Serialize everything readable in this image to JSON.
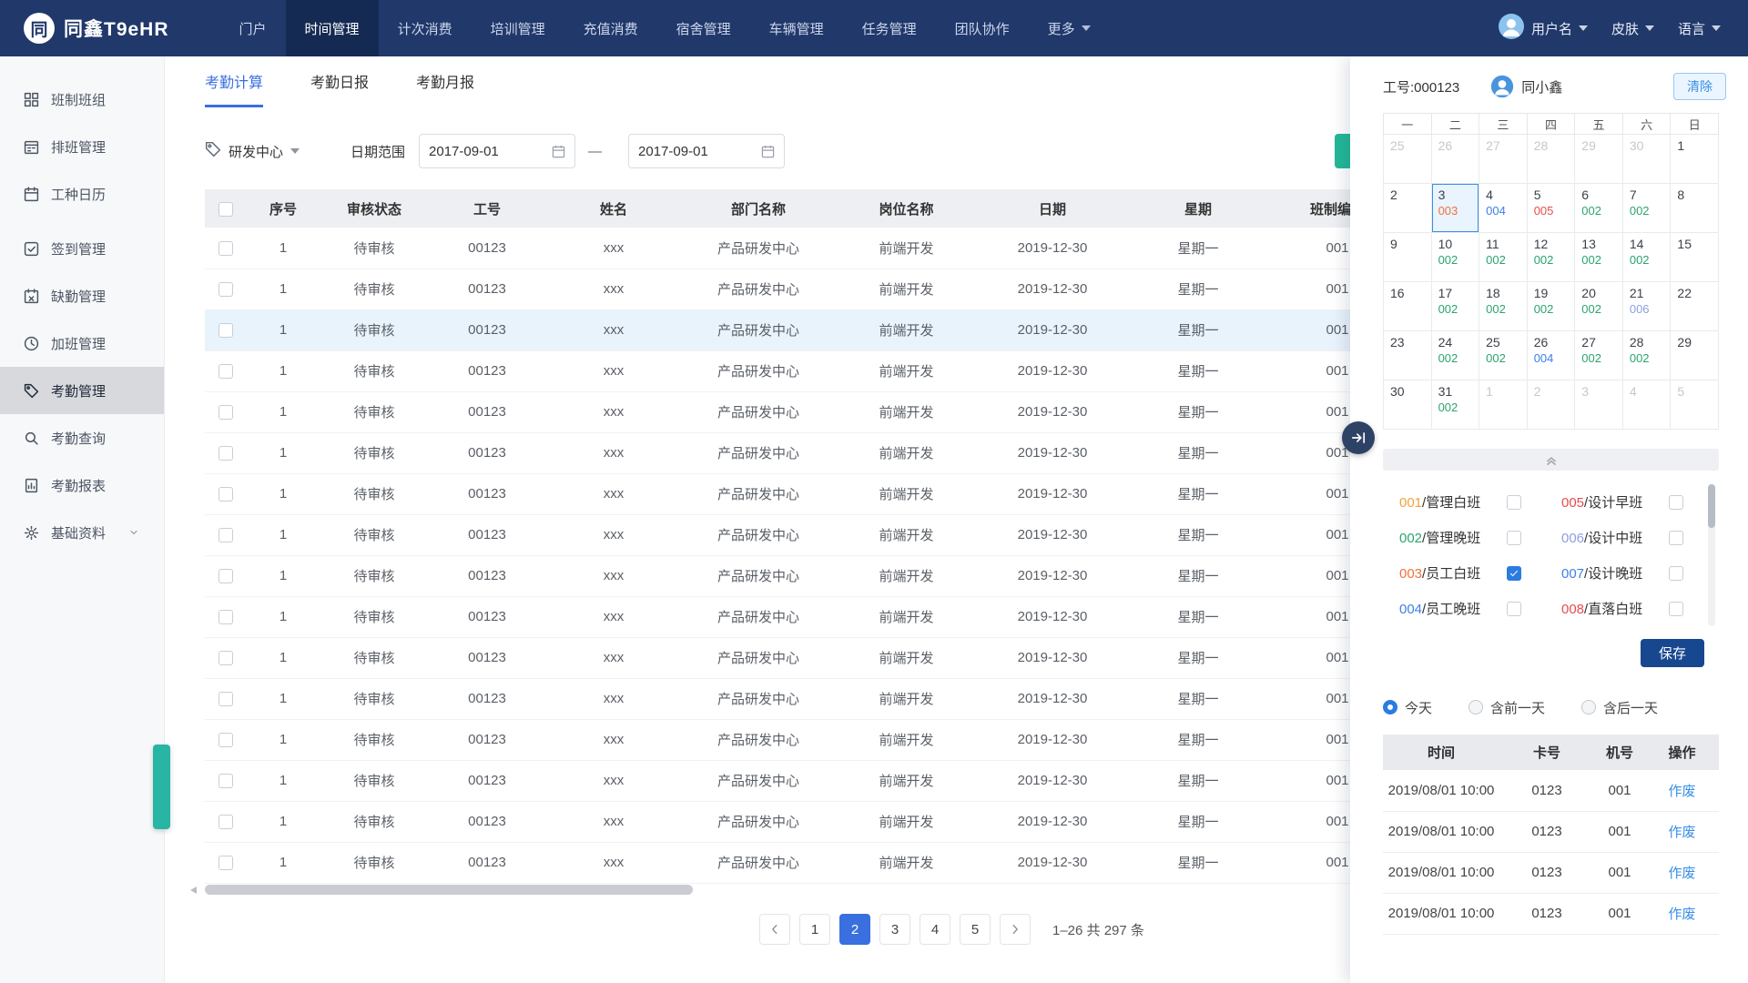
{
  "navbar": {
    "brand": "同鑫T9eHR",
    "logo_text": "同",
    "items": [
      {
        "label": "门户"
      },
      {
        "label": "时间管理",
        "active": true
      },
      {
        "label": "计次消费"
      },
      {
        "label": "培训管理"
      },
      {
        "label": "充值消费"
      },
      {
        "label": "宿舍管理"
      },
      {
        "label": "车辆管理"
      },
      {
        "label": "任务管理"
      },
      {
        "label": "团队协作"
      },
      {
        "label": "更多",
        "dropdown": true
      }
    ],
    "user_label": "用户名",
    "skin_label": "皮肤",
    "language_label": "语言"
  },
  "sidebar": {
    "items": [
      {
        "label": "班制班组",
        "icon": "grid-icon"
      },
      {
        "label": "排班管理",
        "icon": "schedule-icon"
      },
      {
        "label": "工种日历",
        "icon": "calendar-icon"
      },
      {
        "label": "签到管理",
        "icon": "checkin-icon",
        "gap": true
      },
      {
        "label": "缺勤管理",
        "icon": "absence-icon"
      },
      {
        "label": "加班管理",
        "icon": "overtime-icon"
      },
      {
        "label": "考勤管理",
        "icon": "attendance-icon",
        "active": true
      },
      {
        "label": "考勤查询",
        "icon": "query-icon"
      },
      {
        "label": "考勤报表",
        "icon": "report-icon"
      },
      {
        "label": "基础资料",
        "icon": "database-icon",
        "expandable": true
      }
    ]
  },
  "tabs": [
    {
      "label": "考勤计算",
      "active": true
    },
    {
      "label": "考勤日报"
    },
    {
      "label": "考勤月报"
    }
  ],
  "filters": {
    "department": "研发中心",
    "date_range_label": "日期范围",
    "date_from": "2017-09-01",
    "date_to": "2017-09-01"
  },
  "table": {
    "headers": [
      "序号",
      "审核状态",
      "工号",
      "姓名",
      "部门名称",
      "岗位名称",
      "日期",
      "星期",
      "班制编号"
    ],
    "highlighted_row": 2,
    "rows": [
      [
        "1",
        "待审核",
        "00123",
        "xxx",
        "产品研发中心",
        "前端开发",
        "2019-12-30",
        "星期一",
        "001"
      ],
      [
        "1",
        "待审核",
        "00123",
        "xxx",
        "产品研发中心",
        "前端开发",
        "2019-12-30",
        "星期一",
        "001"
      ],
      [
        "1",
        "待审核",
        "00123",
        "xxx",
        "产品研发中心",
        "前端开发",
        "2019-12-30",
        "星期一",
        "001"
      ],
      [
        "1",
        "待审核",
        "00123",
        "xxx",
        "产品研发中心",
        "前端开发",
        "2019-12-30",
        "星期一",
        "001"
      ],
      [
        "1",
        "待审核",
        "00123",
        "xxx",
        "产品研发中心",
        "前端开发",
        "2019-12-30",
        "星期一",
        "001"
      ],
      [
        "1",
        "待审核",
        "00123",
        "xxx",
        "产品研发中心",
        "前端开发",
        "2019-12-30",
        "星期一",
        "001"
      ],
      [
        "1",
        "待审核",
        "00123",
        "xxx",
        "产品研发中心",
        "前端开发",
        "2019-12-30",
        "星期一",
        "001"
      ],
      [
        "1",
        "待审核",
        "00123",
        "xxx",
        "产品研发中心",
        "前端开发",
        "2019-12-30",
        "星期一",
        "001"
      ],
      [
        "1",
        "待审核",
        "00123",
        "xxx",
        "产品研发中心",
        "前端开发",
        "2019-12-30",
        "星期一",
        "001"
      ],
      [
        "1",
        "待审核",
        "00123",
        "xxx",
        "产品研发中心",
        "前端开发",
        "2019-12-30",
        "星期一",
        "001"
      ],
      [
        "1",
        "待审核",
        "00123",
        "xxx",
        "产品研发中心",
        "前端开发",
        "2019-12-30",
        "星期一",
        "001"
      ],
      [
        "1",
        "待审核",
        "00123",
        "xxx",
        "产品研发中心",
        "前端开发",
        "2019-12-30",
        "星期一",
        "001"
      ],
      [
        "1",
        "待审核",
        "00123",
        "xxx",
        "产品研发中心",
        "前端开发",
        "2019-12-30",
        "星期一",
        "001"
      ],
      [
        "1",
        "待审核",
        "00123",
        "xxx",
        "产品研发中心",
        "前端开发",
        "2019-12-30",
        "星期一",
        "001"
      ],
      [
        "1",
        "待审核",
        "00123",
        "xxx",
        "产品研发中心",
        "前端开发",
        "2019-12-30",
        "星期一",
        "001"
      ],
      [
        "1",
        "待审核",
        "00123",
        "xxx",
        "产品研发中心",
        "前端开发",
        "2019-12-30",
        "星期一",
        "001"
      ]
    ]
  },
  "pagination": {
    "pages": [
      "1",
      "2",
      "3",
      "4",
      "5"
    ],
    "active_page": "2",
    "summary": "1–26 共 297 条"
  },
  "panel": {
    "employee_no": "工号:000123",
    "employee_name": "同小鑫",
    "clear_button": "清除",
    "calendar": {
      "weekdays": [
        "一",
        "二",
        "三",
        "四",
        "五",
        "六",
        "日"
      ],
      "cells": [
        {
          "day": "25",
          "other": true
        },
        {
          "day": "26",
          "other": true
        },
        {
          "day": "27",
          "other": true
        },
        {
          "day": "28",
          "other": true
        },
        {
          "day": "29",
          "other": true
        },
        {
          "day": "30",
          "other": true
        },
        {
          "day": "1"
        },
        {
          "day": "2"
        },
        {
          "day": "3",
          "code": "003",
          "selected": true
        },
        {
          "day": "4",
          "code": "004"
        },
        {
          "day": "5",
          "code": "005"
        },
        {
          "day": "6",
          "code": "002"
        },
        {
          "day": "7",
          "code": "002"
        },
        {
          "day": "8"
        },
        {
          "day": "9"
        },
        {
          "day": "10",
          "code": "002"
        },
        {
          "day": "11",
          "code": "002"
        },
        {
          "day": "12",
          "code": "002"
        },
        {
          "day": "13",
          "code": "002"
        },
        {
          "day": "14",
          "code": "002"
        },
        {
          "day": "15"
        },
        {
          "day": "16"
        },
        {
          "day": "17",
          "code": "002"
        },
        {
          "day": "18",
          "code": "002"
        },
        {
          "day": "19",
          "code": "002"
        },
        {
          "day": "20",
          "code": "002"
        },
        {
          "day": "21",
          "code": "006"
        },
        {
          "day": "22"
        },
        {
          "day": "23"
        },
        {
          "day": "24",
          "code": "002"
        },
        {
          "day": "25",
          "code": "002"
        },
        {
          "day": "26",
          "code": "004"
        },
        {
          "day": "27",
          "code": "002"
        },
        {
          "day": "28",
          "code": "002"
        },
        {
          "day": "29"
        },
        {
          "day": "30"
        },
        {
          "day": "31",
          "code": "002"
        },
        {
          "day": "1",
          "other": true
        },
        {
          "day": "2",
          "other": true
        },
        {
          "day": "3",
          "other": true
        },
        {
          "day": "4",
          "other": true
        },
        {
          "day": "5",
          "other": true
        }
      ]
    },
    "shift_colors": {
      "001": "#f5a03c",
      "002": "#2aa56d",
      "003": "#f2703a",
      "004": "#3d7fe8",
      "005": "#e84c4c",
      "006": "#8f9fe0",
      "007": "#3d7fe8",
      "008": "#e84c4c"
    },
    "shifts": [
      {
        "code": "001",
        "name": "管理白班",
        "checked": false
      },
      {
        "code": "005",
        "name": "设计早班",
        "checked": false
      },
      {
        "code": "002",
        "name": "管理晚班",
        "checked": false
      },
      {
        "code": "006",
        "name": "设计中班",
        "checked": false
      },
      {
        "code": "003",
        "name": "员工白班",
        "checked": true
      },
      {
        "code": "007",
        "name": "设计晚班",
        "checked": false
      },
      {
        "code": "004",
        "name": "员工晚班",
        "checked": false
      },
      {
        "code": "008",
        "name": "直落白班",
        "checked": false
      }
    ],
    "save_button": "保存",
    "radios": [
      {
        "label": "今天",
        "checked": true
      },
      {
        "label": "含前一天",
        "checked": false
      },
      {
        "label": "含后一天",
        "checked": false
      }
    ],
    "log_table": {
      "headers": [
        "时间",
        "卡号",
        "机号",
        "操作"
      ],
      "rows": [
        {
          "time": "2019/08/01 10:00",
          "card": "0123",
          "machine": "001",
          "action": "作废"
        },
        {
          "time": "2019/08/01 10:00",
          "card": "0123",
          "machine": "001",
          "action": "作废"
        },
        {
          "time": "2019/08/01 10:00",
          "card": "0123",
          "machine": "001",
          "action": "作废"
        },
        {
          "time": "2019/08/01 10:00",
          "card": "0123",
          "machine": "001",
          "action": "作废"
        }
      ]
    }
  }
}
